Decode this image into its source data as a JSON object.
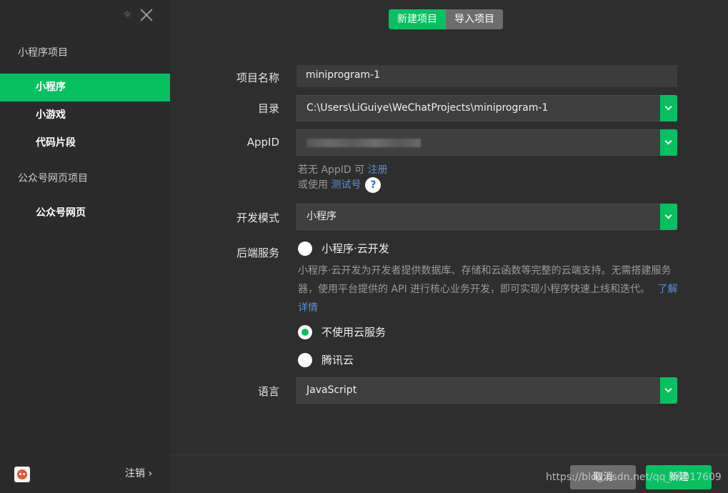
{
  "sidebar": {
    "group1_title": "小程序项目",
    "items": [
      {
        "label": "小程序"
      },
      {
        "label": "小游戏"
      },
      {
        "label": "代码片段"
      }
    ],
    "group2_title": "公众号网页项目",
    "items2": [
      {
        "label": "公众号网页"
      }
    ],
    "logout_label": "注销 ›"
  },
  "tabs": [
    {
      "label": "新建项目"
    },
    {
      "label": "导入项目"
    }
  ],
  "form": {
    "name_label": "项目名称",
    "name_value": "miniprogram-1",
    "dir_label": "目录",
    "dir_value": "C:\\Users\\LiGuiye\\WeChatProjects\\miniprogram-1",
    "appid_label": "AppID",
    "hint1_prefix": "若无 AppID 可 ",
    "hint1_link": "注册",
    "hint2_prefix": "或使用 ",
    "hint2_link": "测试号",
    "help_glyph": "?",
    "mode_label": "开发模式",
    "mode_value": "小程序",
    "backend_label": "后端服务",
    "option_cloud": "小程序·云开发",
    "cloud_desc": "小程序·云开发为开发者提供数据库、存储和云函数等完整的云端支持。无需搭建服务器，使用平台提供的 API 进行核心业务开发，即可实现小程序快速上线和迭代。",
    "cloud_link": "了解详情",
    "option_none": "不使用云服务",
    "option_tencent": "腾讯云",
    "lang_label": "语言",
    "lang_value": "JavaScript"
  },
  "footer": {
    "cancel_label": "取消",
    "create_label": "新建"
  },
  "watermark": "https://blog.csdn.net/qq_36017609",
  "colors": {
    "accent": "#07c160",
    "link": "#5b8fd6"
  }
}
